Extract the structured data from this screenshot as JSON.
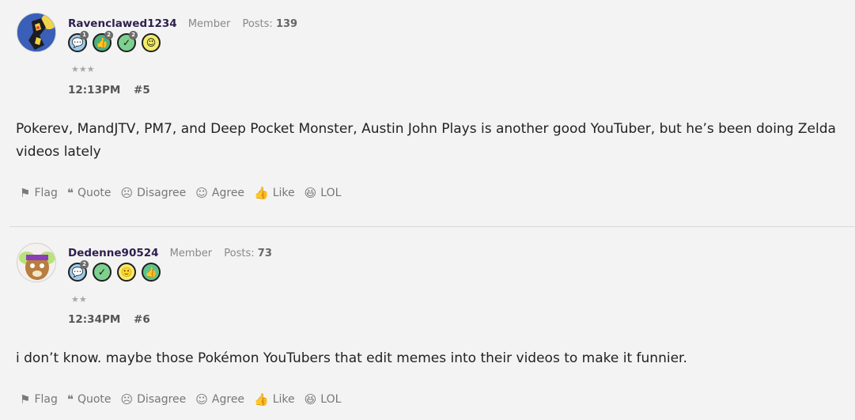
{
  "posts": [
    {
      "username": "Ravenclawed1234",
      "role": "Member",
      "posts_label": "Posts:",
      "posts_count": "139",
      "badges": [
        {
          "icon": "speech-bubble-icon",
          "color": "#9ecbec",
          "count": "1"
        },
        {
          "icon": "thumbs-up-icon",
          "color": "#4fb07a",
          "count": "2"
        },
        {
          "icon": "checkmark-icon",
          "color": "#7dd08d",
          "count": "2"
        },
        {
          "icon": "wink-face-icon",
          "color": "#f4ec6a",
          "count": ""
        }
      ],
      "stars": "★★★",
      "time": "12:13PM",
      "post_number": "#5",
      "content": "Pokerev, MandJTV, PM7, and Deep Pocket Monster, Austin John Plays is another good YouTuber, but he’s been doing Zelda videos lately"
    },
    {
      "username": "Dedenne90524",
      "role": "Member",
      "posts_label": "Posts:",
      "posts_count": "73",
      "badges": [
        {
          "icon": "speech-bubble-icon",
          "color": "#9ecbec",
          "count": "2"
        },
        {
          "icon": "checkmark-icon",
          "color": "#7dd08d",
          "count": ""
        },
        {
          "icon": "smile-face-icon",
          "color": "#f4ec6a",
          "count": ""
        },
        {
          "icon": "thumbs-up-icon",
          "color": "#5fc38a",
          "count": ""
        }
      ],
      "stars": "★★",
      "time": "12:34PM",
      "post_number": "#6",
      "content": "i don’t know. maybe those Pokémon YouTubers that edit memes into their videos to make it funnier."
    }
  ],
  "actions": {
    "flag": "Flag",
    "quote": "Quote",
    "disagree": "Disagree",
    "agree": "Agree",
    "like": "Like",
    "lol": "LOL"
  }
}
